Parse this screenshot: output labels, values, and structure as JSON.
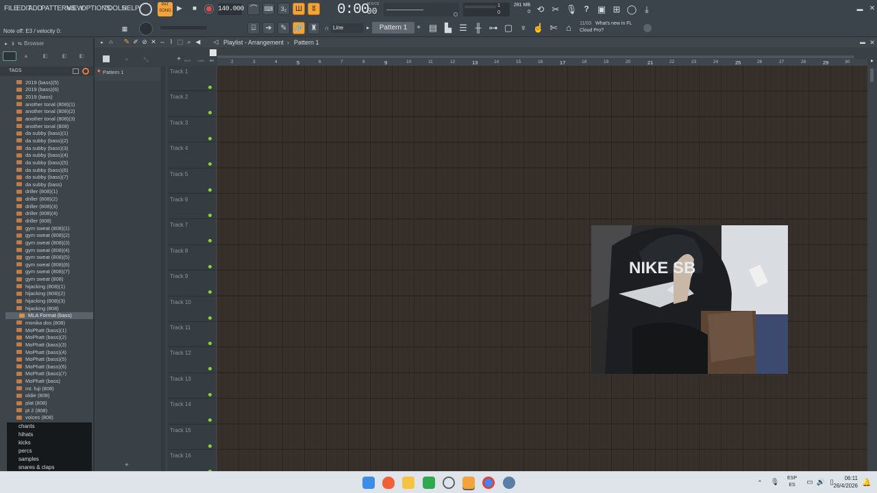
{
  "menu": [
    "FILE",
    "EDIT",
    "ADD",
    "PATTERNS",
    "VIEW",
    "OPTIONS",
    "TOOLS",
    "HELP"
  ],
  "transport": {
    "mode_top": "PAT",
    "mode_bottom": "SONG",
    "tempo": "140.000",
    "time": "0:00",
    "time_small": "00",
    "time_label": "M:S:CS",
    "cpu_value": "1",
    "poly_value": "0",
    "memory": "281 MB",
    "memory_sub": "0"
  },
  "hint_bar": "Note off: E3 / velocity 0:",
  "toolbar": {
    "snap": "Line",
    "pattern_selector": "Pattern 1",
    "news_date": "11/03",
    "news_text_1": "What's new in FL",
    "news_text_2": "Cloud Pro?"
  },
  "browser": {
    "title": "Browser",
    "tags_label": "TAGS",
    "items": [
      "2019 (bass)(5)",
      "2019 (bass)(6)",
      "2019 (bass)",
      "another tonal (808)(1)",
      "another tonal (808)(2)",
      "another tonal (808)(3)",
      "another tonal (808)",
      "da subby (bass)(1)",
      "da subby (bass)(2)",
      "da subby (bass)(3)",
      "da subby (bass)(4)",
      "da subby (bass)(5)",
      "da subby (bass)(6)",
      "da subby (bass)(7)",
      "da subby (bass)",
      "driller (808)(1)",
      "driller (808)(2)",
      "driller (808)(3)",
      "driller (808)(4)",
      "driller (808)",
      "gym sweat (808)(1)",
      "gym sweat (808)(2)",
      "gym sweat (808)(3)",
      "gym sweat (808)(4)",
      "gym sweat (808)(5)",
      "gym sweat (808)(6)",
      "gym sweat (808)(7)",
      "gym sweat (808)",
      "hijacking (808)(1)",
      "hijacking (808)(2)",
      "hijacking (808)(3)",
      "hijacking (808)",
      "MLA Format (bass)",
      "monika dos (808)",
      "MoPhatt (bass)(1)",
      "MoPhatt (bass)(2)",
      "MoPhatt (bass)(3)",
      "MoPhatt (bass)(4)",
      "MoPhatt (bass)(5)",
      "MoPhatt (bass)(6)",
      "MoPhatt (bass)(7)",
      "MoPhatt (bass)",
      "mt. fuji (808)",
      "oldie (808)",
      "plat (808)",
      "pt 2 (808)",
      "voices (808)"
    ],
    "selected_item": "MLA Format (bass)",
    "categories": [
      "chants",
      "hihats",
      "kicks",
      "percs",
      "samples",
      "snares & claps"
    ]
  },
  "playlist": {
    "title": "Playlist - Arrangement",
    "breadcrumb_pattern": "Pattern 1",
    "pattern_list": [
      "Pattern 1"
    ],
    "header_labels": [
      "MUTE",
      "CHAN",
      "PAT"
    ],
    "tracks": [
      "Track 1",
      "Track 2",
      "Track 3",
      "Track 4",
      "Track 5",
      "Track 6",
      "Track 7",
      "Track 8",
      "Track 9",
      "Track 10",
      "Track 11",
      "Track 12",
      "Track 13",
      "Track 14",
      "Track 15",
      "Track 16"
    ],
    "ruler": [
      "2",
      "3",
      "4",
      "5",
      "6",
      "7",
      "8",
      "9",
      "10",
      "11",
      "12",
      "13",
      "14",
      "15",
      "16",
      "17",
      "18",
      "19",
      "20",
      "21",
      "22",
      "23",
      "24",
      "25",
      "26",
      "27",
      "28",
      "29",
      "30"
    ]
  },
  "webcam": {
    "shirt_text": "NIKE SB"
  },
  "taskbar": {
    "lang_top": "ESP",
    "lang_bottom": "ES",
    "time": "06:11",
    "date": "26/4/2026"
  },
  "colors": {
    "accent": "#f3a33b",
    "track_led": "#8ad23c",
    "grid_bg": "#362f2a"
  }
}
